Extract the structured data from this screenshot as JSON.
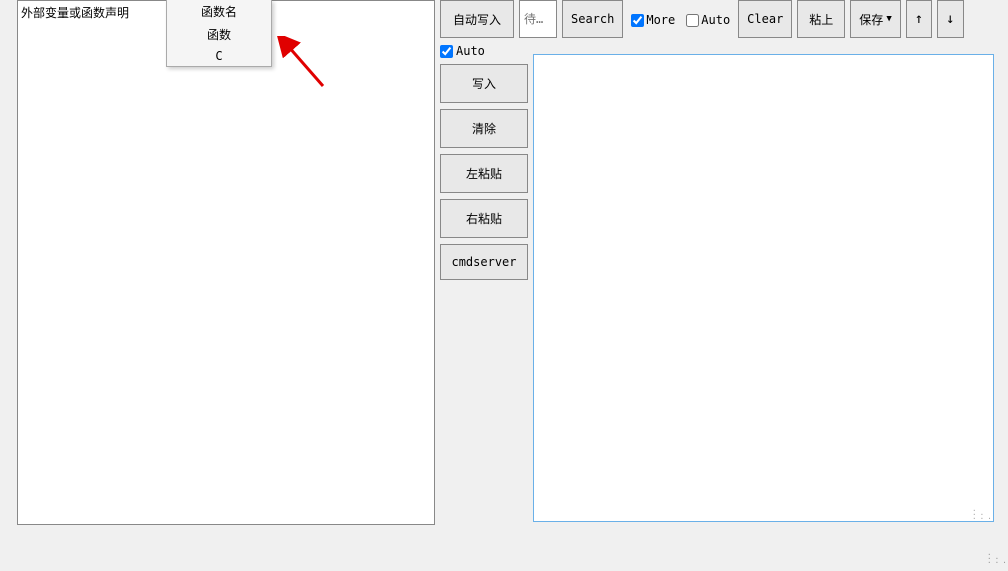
{
  "leftPanel": {
    "text": "外部变量或函数声明"
  },
  "contextMenu": {
    "items": [
      "函数名",
      "函数",
      "C"
    ]
  },
  "toolbar": {
    "autoWrite": "自动写入",
    "inputPlaceholder": "待…",
    "search": "Search",
    "moreLabel": "More",
    "autoLabel": "Auto",
    "clear": "Clear",
    "paste": "粘上",
    "save": "保存",
    "up": "↑",
    "down": "↓"
  },
  "sidebar": {
    "autoLabel": "Auto",
    "buttons": {
      "write": "写入",
      "clear": "清除",
      "pasteLeft": "左粘贴",
      "pasteRight": "右粘贴",
      "cmdserver": "cmdserver"
    }
  }
}
